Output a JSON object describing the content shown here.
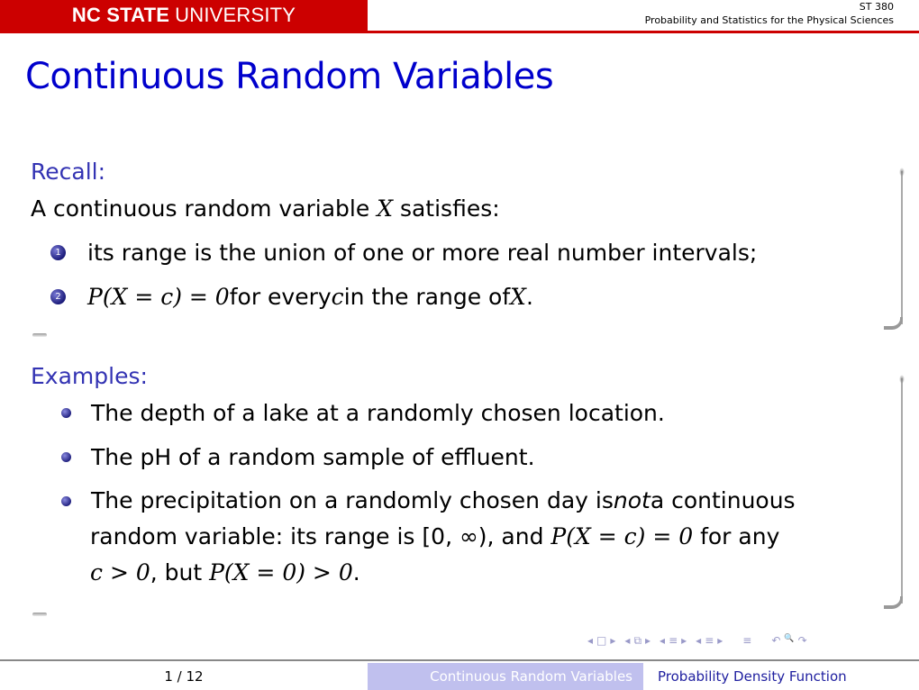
{
  "header": {
    "university_bold": "NC STATE",
    "university_rest": "UNIVERSITY",
    "course_code": "ST 380",
    "course_name": "Probability and Statistics for the Physical Sciences"
  },
  "slide": {
    "title": "Continuous Random Variables",
    "recall": {
      "heading": "Recall:",
      "intro_pre": "A continuous random variable ",
      "intro_var": "X",
      "intro_post": " satisfies:",
      "items": [
        {
          "number": "1",
          "text": "its range is the union of one or more real number intervals;"
        },
        {
          "number": "2",
          "math": "P(X = c) = 0",
          "text_a": " for every ",
          "var_c": "c",
          "text_b": " in the range of ",
          "var_x": "X",
          "text_c": "."
        }
      ]
    },
    "examples": {
      "heading": "Examples:",
      "items": [
        "The depth of a lake at a randomly chosen location.",
        "The pH of a random sample of effluent."
      ],
      "item3_line1_pre": "The precipitation on a randomly chosen day is ",
      "item3_line1_em": "not",
      "item3_line1_post": " a continuous",
      "item3_line2_pre": "random variable: its range is [0, ∞), and ",
      "item3_line2_math": "P(X = c) = 0",
      "item3_line2_post": " for any",
      "item3_line3_math1": "c > 0",
      "item3_line3_mid": ", but ",
      "item3_line3_math2": "P(X = 0) > 0",
      "item3_line3_end": "."
    }
  },
  "nav": {
    "symbols": [
      "◂",
      "□",
      "▸",
      "◂",
      "⧉",
      "▸",
      "◂",
      "≡",
      "▸",
      "◂",
      "≡",
      "▸",
      "≡",
      "↶",
      "🔍",
      "↷"
    ]
  },
  "footer": {
    "page": "1 / 12",
    "section": "Continuous Random Variables",
    "subsection": "Probability Density Function"
  }
}
